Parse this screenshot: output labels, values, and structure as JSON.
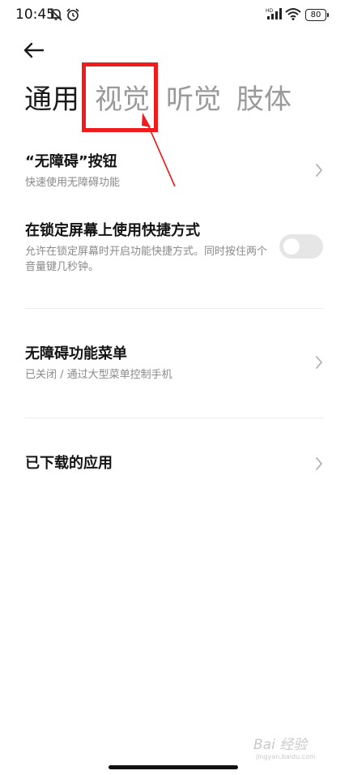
{
  "status_bar": {
    "time": "10:45",
    "network_label": "HD",
    "battery": "80"
  },
  "tabs": [
    {
      "label": "通用"
    },
    {
      "label": "视觉"
    },
    {
      "label": "听觉"
    },
    {
      "label": "肢体"
    }
  ],
  "settings": [
    {
      "title": "“无障碍”按钮",
      "subtitle": "快速使用无障碍功能"
    },
    {
      "title": "在锁定屏幕上使用快捷方式",
      "subtitle": "允许在锁定屏幕时开启功能快捷方式。同时按住两个音量键几秒钟。",
      "toggle_on": false
    },
    {
      "title": "无障碍功能菜单",
      "subtitle": "已关闭 / 通过大型菜单控制手机"
    },
    {
      "title": "已下载的应用"
    }
  ],
  "watermark": {
    "main": "Bai 经验",
    "sub": "jingyan.baidu.com"
  },
  "colors": {
    "annotation": "#ee1c1c",
    "active_tab": "#1a1a1a",
    "inactive_tab": "#9a9a9a",
    "toggle_off": "#e6e6e6"
  },
  "icons": [
    "mute-icon",
    "alarm-icon",
    "signal-icon",
    "wifi-icon",
    "battery-icon",
    "back-arrow-icon",
    "chevron-right-icon"
  ]
}
